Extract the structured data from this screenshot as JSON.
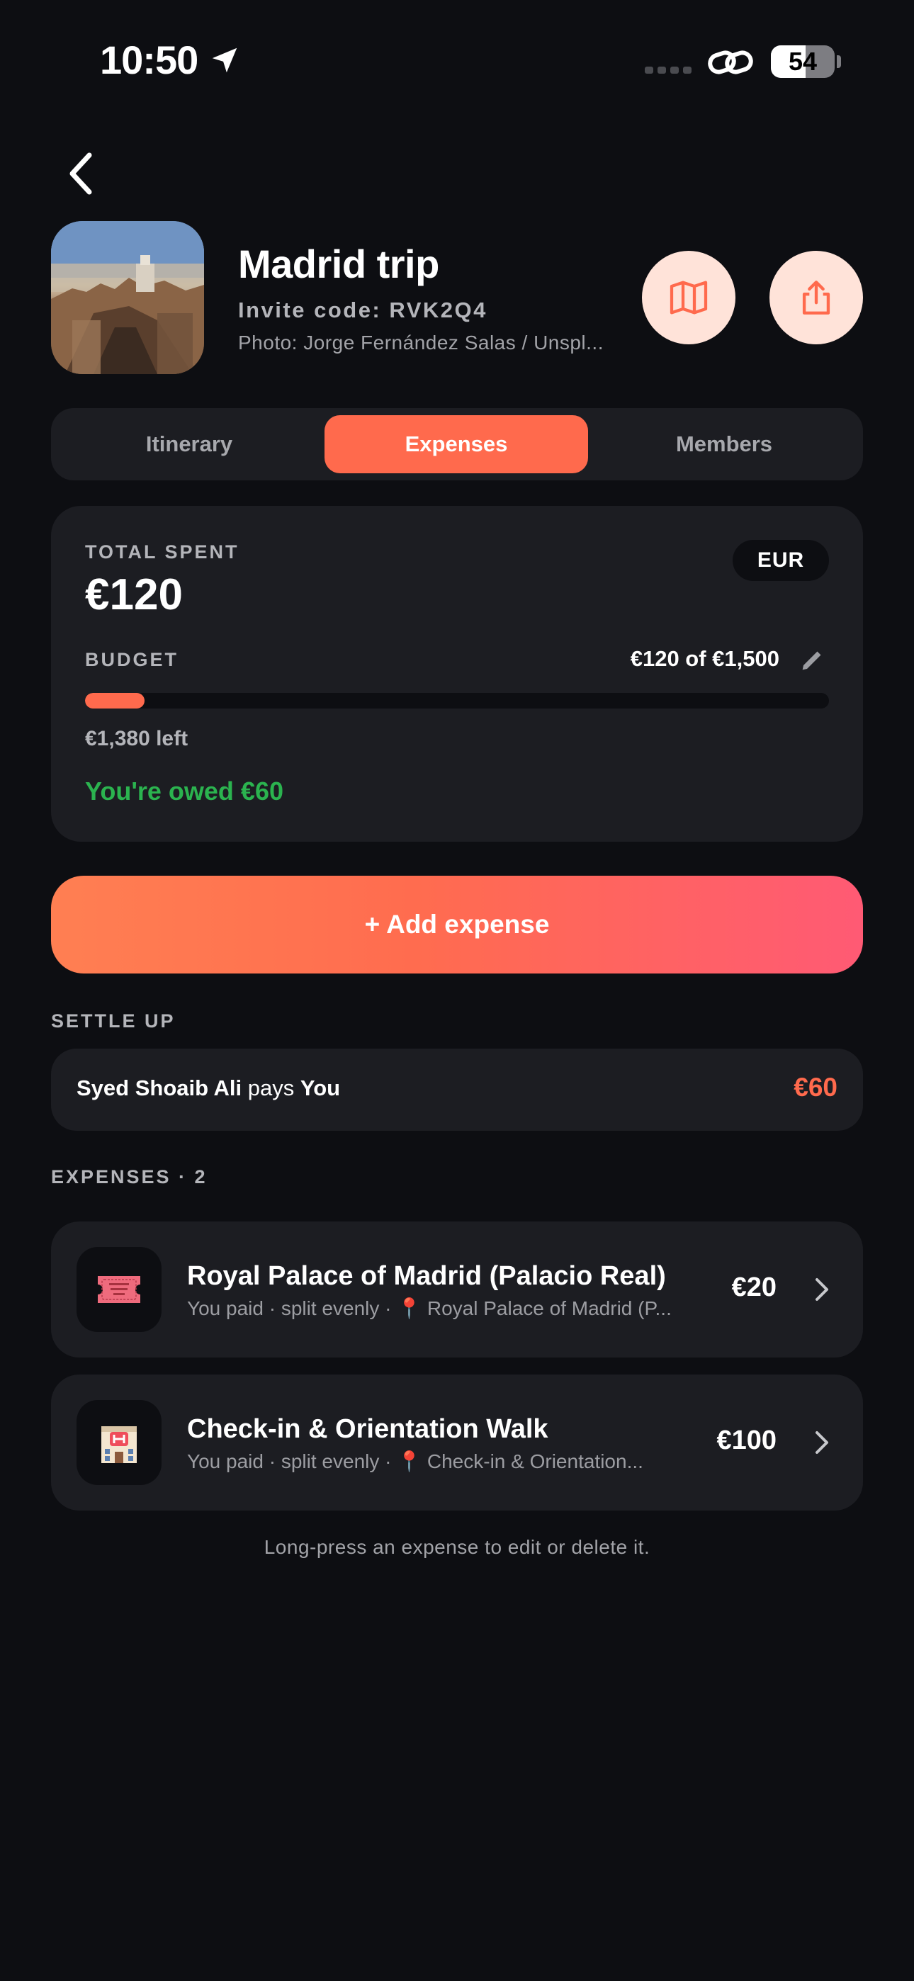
{
  "status_bar": {
    "time": "10:50",
    "battery": "54",
    "battery_level": 0.54
  },
  "header": {
    "title": "Madrid trip",
    "invite_code": "Invite code: RVK2Q4",
    "photo_credit": "Photo: Jorge Fernández Salas / Unspl..."
  },
  "icons": {
    "back": "chevron-left-icon",
    "map": "map-icon",
    "share": "share-icon",
    "edit": "pencil-icon",
    "location_pin": "📍",
    "ticket": "admit-one-ticket-icon",
    "hotel": "🏨"
  },
  "tabs": [
    {
      "label": "Itinerary",
      "active": false
    },
    {
      "label": "Expenses",
      "active": true
    },
    {
      "label": "Members",
      "active": false
    }
  ],
  "summary": {
    "total_label": "TOTAL SPENT",
    "total_value": "€120",
    "currency": "EUR",
    "budget_label": "BUDGET",
    "budget_amount": "€120 of €1,500",
    "budget_progress": 0.08,
    "left_text": "€1,380 left",
    "owed_text": "You're owed €60"
  },
  "add_expense_label": "+ Add expense",
  "settle": {
    "section_label": "SETTLE UP",
    "payer": "Syed Shoaib Ali",
    "verb": "pays",
    "payee": "You",
    "amount": "€60"
  },
  "expenses": {
    "section_label": "EXPENSES · 2",
    "items": [
      {
        "title": "Royal Palace of Madrid (Palacio Real)",
        "subtitle": "You paid · split evenly · 📍 Royal Palace of Madrid (P...",
        "amount": "€20",
        "icon": "admit-one-ticket-icon"
      },
      {
        "title": "Check-in & Orientation Walk",
        "subtitle": "You paid · split evenly · 📍 Check-in & Orientation...",
        "amount": "€100",
        "icon": "hotel-icon"
      }
    ]
  },
  "footer_hint": "Long-press an expense to edit or delete it.",
  "colors": {
    "background": "#0d0e12",
    "card": "#1c1d22",
    "accent": "#ff6a4d",
    "accent_pink": "#ff5a74",
    "positive": "#2bb34f",
    "circle_button": "#ffe3d9"
  }
}
